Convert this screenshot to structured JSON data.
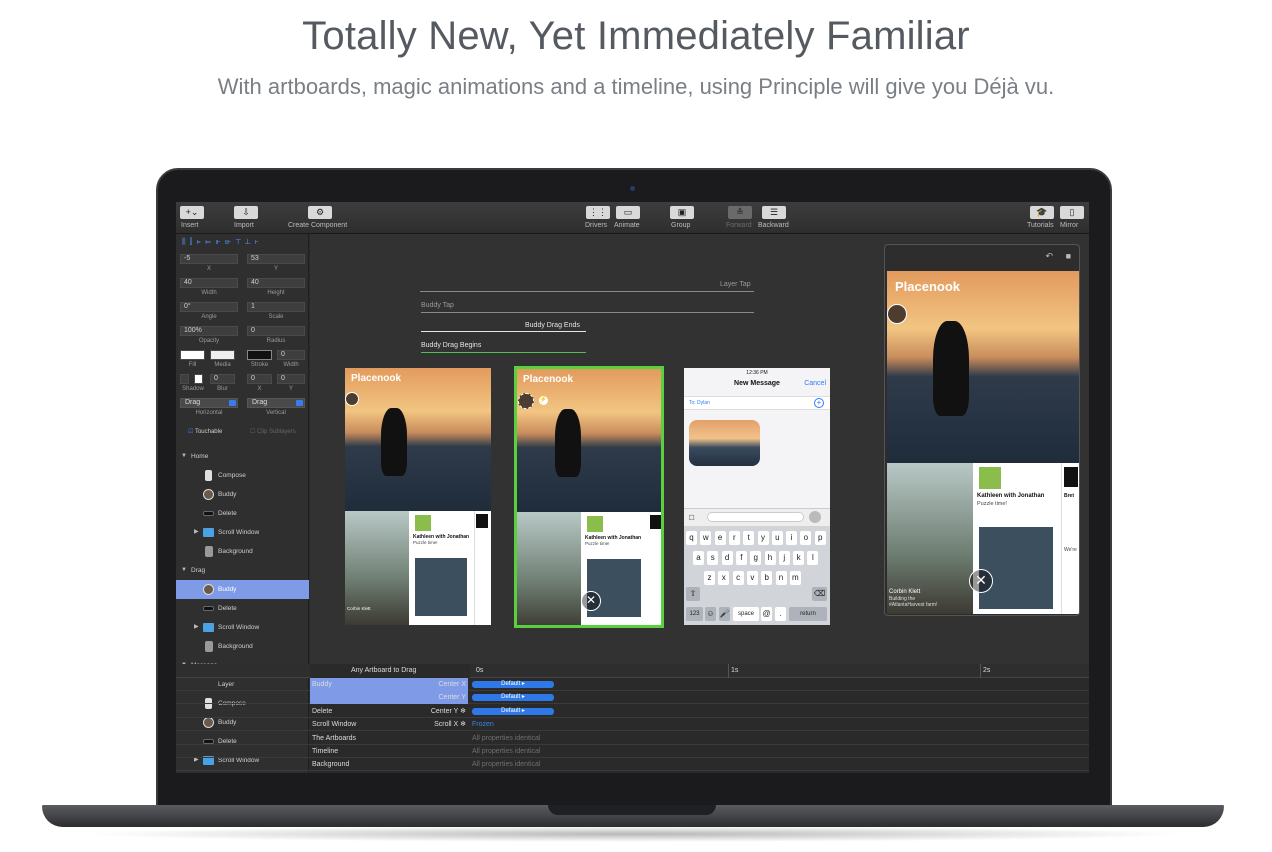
{
  "hero": {
    "title": "Totally New, Yet Immediately Familiar",
    "subtitle": "With artboards, magic animations and a timeline, using Principle will give you Déjà vu."
  },
  "toolbar": {
    "insert": "Insert",
    "import": "Import",
    "create_component": "Create Component",
    "drivers": "Drivers",
    "animate": "Animate",
    "group": "Group",
    "forward": "Forward",
    "backward": "Backward",
    "tutorials": "Tutorials",
    "mirror": "Mirror"
  },
  "inspector": {
    "x_value": "-5",
    "y_value": "53",
    "x_label": "X",
    "y_label": "Y",
    "width_value": "40",
    "height_value": "40",
    "width_label": "Width",
    "height_label": "Height",
    "angle_value": "0°",
    "scale_value": "1",
    "angle_label": "Angle",
    "scale_label": "Scale",
    "opacity_value": "100%",
    "radius_value": "0",
    "opacity_label": "Opacity",
    "radius_label": "Radius",
    "fill_label": "Fill",
    "media_label": "Media",
    "stroke_label": "Stroke",
    "stroke_width_value": "0",
    "width2_label": "Width",
    "shadow_label": "Shadow",
    "blur_value": "0",
    "blur_label": "Blur",
    "sx_value": "0",
    "sy_value": "0",
    "sx_label": "X",
    "sy_label": "Y",
    "horizontal_value": "Drag",
    "vertical_value": "Drag",
    "horizontal_label": "Horizontal",
    "vertical_label": "Vertical",
    "touchable_label": "Touchable",
    "clip_label": "Clip Sublayers"
  },
  "layers": {
    "home": "Home",
    "compose": "Compose",
    "buddy": "Buddy",
    "delete": "Delete",
    "scroll_window": "Scroll Window",
    "background": "Background",
    "drag": "Drag",
    "buddy2": "Buddy",
    "delete2": "Delete",
    "scroll_window2": "Scroll Window",
    "background2": "Background",
    "message": "Message",
    "layer": "Layer",
    "compose2": "Compose",
    "buddy3": "Buddy",
    "delete3": "Delete",
    "scroll_window3": "Scroll Window"
  },
  "canvas": {
    "layer_tap": "Layer Tap",
    "buddy_tap": "Buddy Tap",
    "buddy_drag_ends": "Buddy Drag Ends",
    "buddy_drag_begins": "Buddy Drag Begins",
    "app_title": "Placenook",
    "card_title": "Kathleen with Jonathan",
    "card_sub": "Puzzle time!",
    "photo_caption_1": "Corbin Klett",
    "photo_caption_2": "Building the",
    "photo_caption_3": "#AtlantaHarvest farm!",
    "card_bret": "Bret",
    "card_were": "We're",
    "msg_time": "12:36 PM",
    "msg_title": "New Message",
    "msg_cancel": "Cancel",
    "msg_to": "To: Dylan",
    "kb_row1": [
      "q",
      "w",
      "e",
      "r",
      "t",
      "y",
      "u",
      "i",
      "o",
      "p"
    ],
    "kb_row2": [
      "a",
      "s",
      "d",
      "f",
      "g",
      "h",
      "j",
      "k",
      "l"
    ],
    "kb_row3": [
      "z",
      "x",
      "c",
      "v",
      "b",
      "n",
      "m"
    ],
    "kb_123": "123",
    "kb_space": "space",
    "kb_at": "@",
    "kb_dot": ".",
    "kb_return": "return"
  },
  "timeline": {
    "header": "Any Artboard to Drag",
    "t0": "0s",
    "t1": "1s",
    "t2": "2s",
    "rows": [
      {
        "name": "Buddy",
        "prop": "Center X",
        "bar": "Default ▸"
      },
      {
        "name": "",
        "prop": "Center Y",
        "bar": "Default ▸"
      },
      {
        "name": "Delete",
        "prop": "Center Y ❄",
        "bar": "Default ▸"
      },
      {
        "name": "Scroll Window",
        "prop": "Scroll X ❄",
        "note": "Frozen"
      },
      {
        "name": "The Artboards",
        "prop": "",
        "note": "All properties identical"
      },
      {
        "name": "Timeline",
        "prop": "",
        "note": "All properties identical"
      },
      {
        "name": "Background",
        "prop": "",
        "note": "All properties identical"
      }
    ]
  }
}
